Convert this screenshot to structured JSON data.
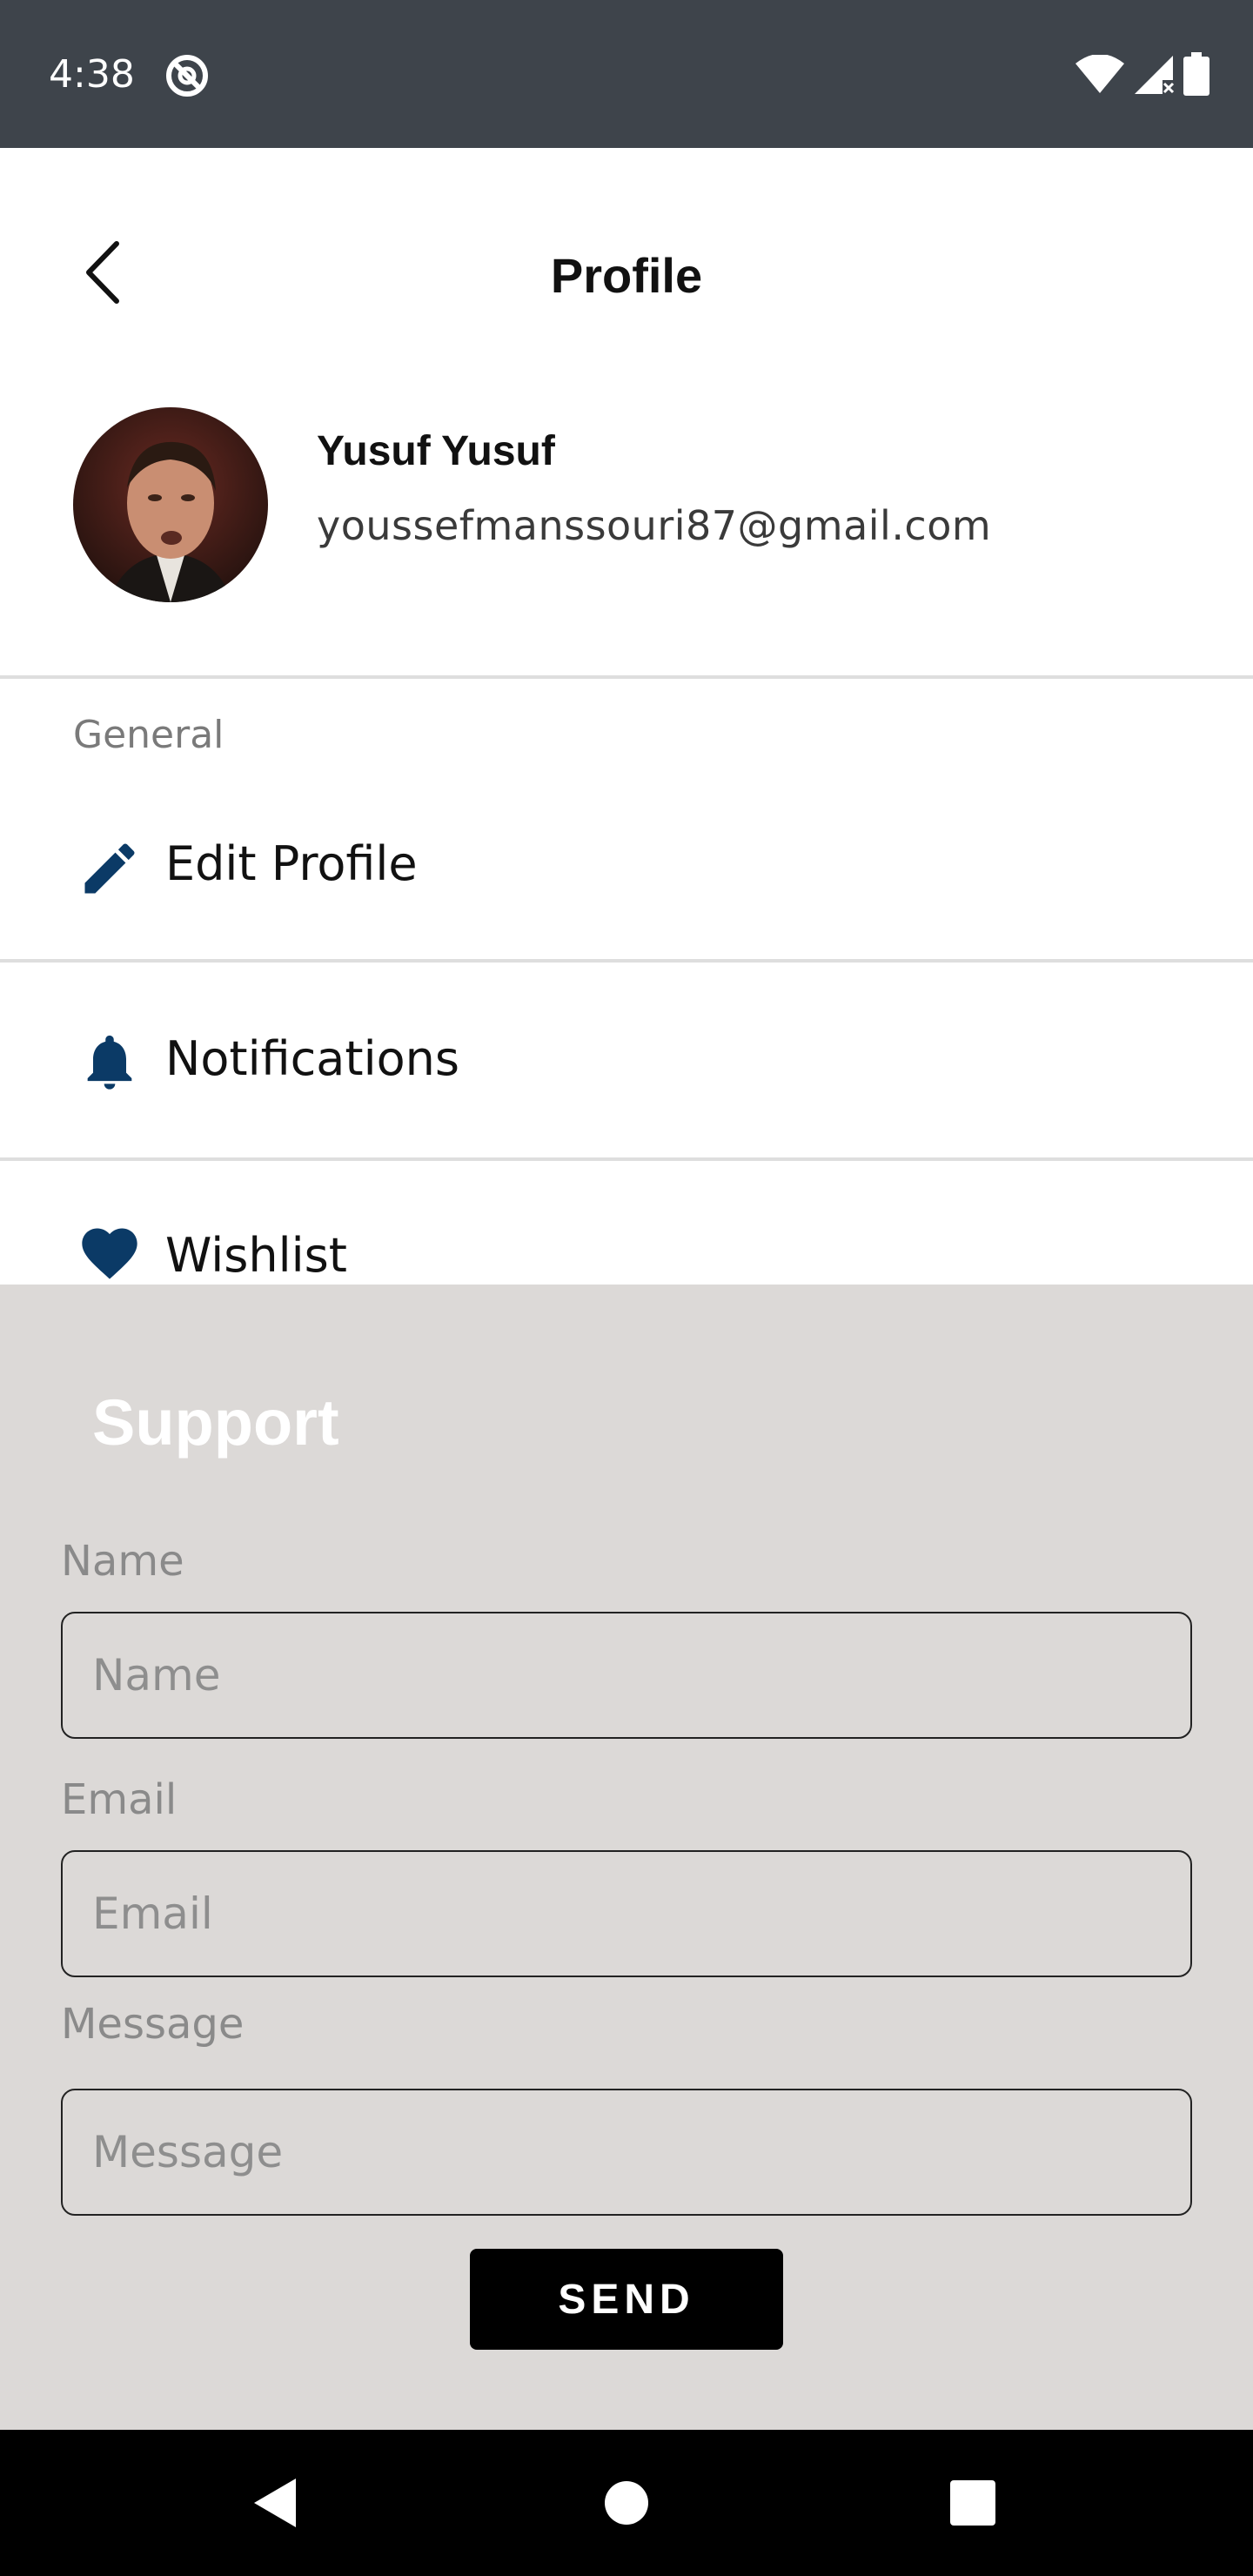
{
  "status_bar": {
    "time": "4:38",
    "icons": [
      "at-sign-icon",
      "wifi-icon",
      "signal-icon",
      "battery-icon"
    ]
  },
  "header": {
    "title": "Profile",
    "back_icon": "chevron-left-icon"
  },
  "profile": {
    "name": "Yusuf Yusuf",
    "email": "youssefmanssouri87@gmail.com"
  },
  "general": {
    "section_label": "General",
    "items": [
      {
        "label": "Edit Profile",
        "icon": "pencil-icon"
      },
      {
        "label": "Notifications",
        "icon": "bell-icon"
      },
      {
        "label": "Wishlist",
        "icon": "heart-icon"
      }
    ]
  },
  "support": {
    "title": "Support",
    "fields": [
      {
        "label": "Name",
        "placeholder": "Name",
        "value": ""
      },
      {
        "label": "Email",
        "placeholder": "Email",
        "value": ""
      },
      {
        "label": "Message",
        "placeholder": "Message",
        "value": ""
      }
    ],
    "send_label": "SEND"
  },
  "nav_bar": {
    "buttons": [
      "back-triangle-icon",
      "home-circle-icon",
      "recents-square-icon"
    ]
  },
  "colors": {
    "status_bar": "#3e444b",
    "icon_accent": "#0b3a66",
    "sheet_background": "#dcd9d7",
    "button": "#000000"
  }
}
